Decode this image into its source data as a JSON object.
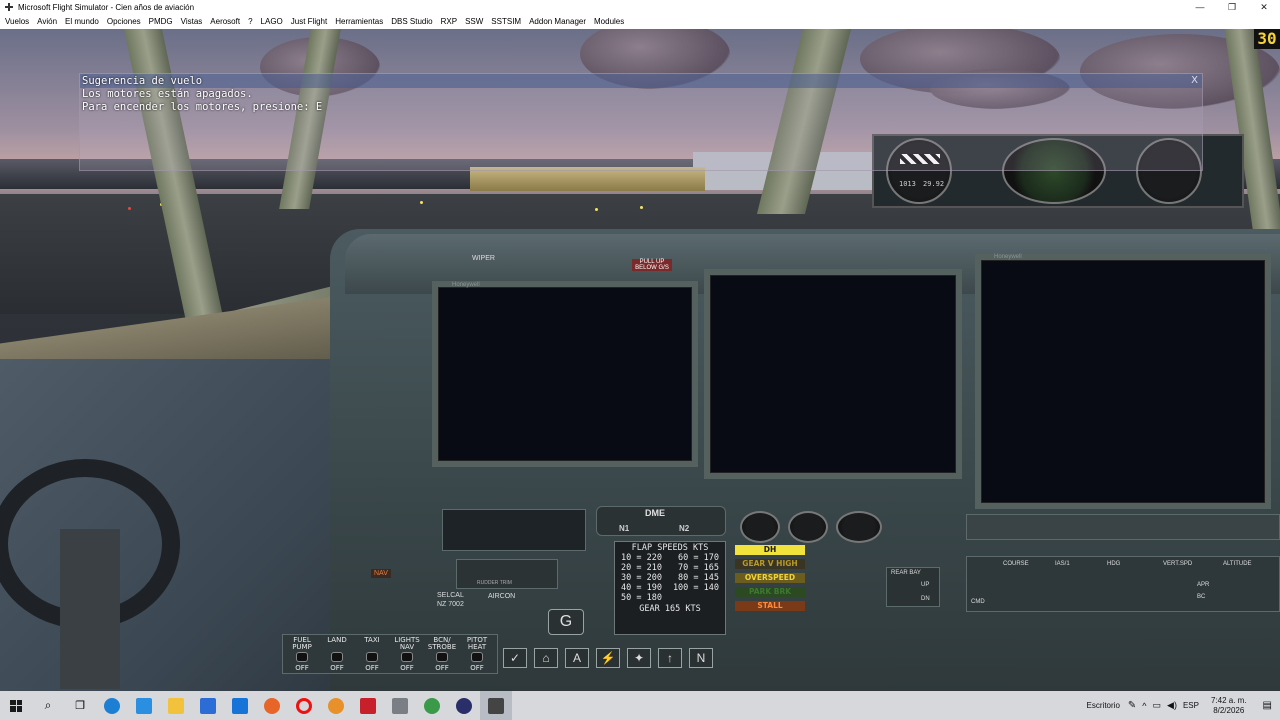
{
  "window": {
    "title": "Microsoft Flight Simulator - Cien años de aviación",
    "min_glyph": "—",
    "max_glyph": "❐",
    "close_glyph": "✕"
  },
  "menu": [
    "Vuelos",
    "Avión",
    "El mundo",
    "Opciones",
    "PMDG",
    "Vistas",
    "Aerosoft",
    "?",
    "LAGO",
    "Just Flight",
    "Herramientas",
    "DBS Studio",
    "RXP",
    "SSW",
    "SSTSIM",
    "Addon Manager",
    "Modules"
  ],
  "fps": "30",
  "tip": {
    "title": "Sugerencia de vuelo",
    "line1": "Los motores están apagados.",
    "line2": "Para encender los motores, presione: E",
    "close": "X"
  },
  "panel": {
    "wiper": "WIPER",
    "pull_up": "PULL UP BELOW G/S",
    "dme": "DME",
    "n1": "N1",
    "n2": "N2",
    "nav": "NAV",
    "selcal": "SELCAL",
    "selcal_code": "NZ 7002",
    "aircon": "AIRCON",
    "rudder_trim": "RUDDER TRIM",
    "honeywell": "Honeywell",
    "rear_bay": "REAR BAY",
    "up": "UP",
    "dn": "DN",
    "course": "COURSE",
    "ias": "IAS/1",
    "hdg": "HDG",
    "vert_spd": "VERT.SPD",
    "altitude": "ALTITUDE",
    "cmd": "CMD",
    "apr": "APR",
    "bc": "BC",
    "alt_baro": "1013",
    "alt_inhg": "29.92"
  },
  "flap_speeds": {
    "header": "FLAP SPEEDS KTS",
    "rows": [
      [
        "10 = 220",
        "60 = 170"
      ],
      [
        "20 = 210",
        "70 = 165"
      ],
      [
        "30 = 200",
        "80 = 145"
      ],
      [
        "40 = 190",
        "100 = 140"
      ],
      [
        "50 = 180",
        ""
      ]
    ],
    "footer": "GEAR 165 KTS"
  },
  "annunciators": [
    {
      "label": "DH",
      "bg": "#f2e23c",
      "fg": "#1a1a1a"
    },
    {
      "label": "GEAR V HIGH",
      "bg": "#3a3522",
      "fg": "#b79a2a"
    },
    {
      "label": "OVERSPEED",
      "bg": "#6a5d1e",
      "fg": "#f1d23b"
    },
    {
      "label": "PARK BRK",
      "bg": "#2c4a22",
      "fg": "#3b7a2c"
    },
    {
      "label": "STALL",
      "bg": "#7a3a17",
      "fg": "#ff8a3a"
    }
  ],
  "toggles": [
    {
      "label": "FUEL PUMP",
      "state": "OFF"
    },
    {
      "label": "LAND",
      "state": "OFF"
    },
    {
      "label": "TAXI",
      "state": "OFF"
    },
    {
      "label": "LIGHTS NAV",
      "state": "OFF"
    },
    {
      "label": "BCN/ STROBE",
      "state": "OFF"
    },
    {
      "label": "PITOT HEAT",
      "state": "OFF"
    }
  ],
  "taskbar": {
    "desktop_label": "Escritorio",
    "lang": "ESP",
    "time": "7:42 a. m.",
    "date": "8/2/2026"
  },
  "colors": {
    "fps": "#f6d23a",
    "display_bg": "#090b14",
    "panel": "#3e4a4c"
  }
}
